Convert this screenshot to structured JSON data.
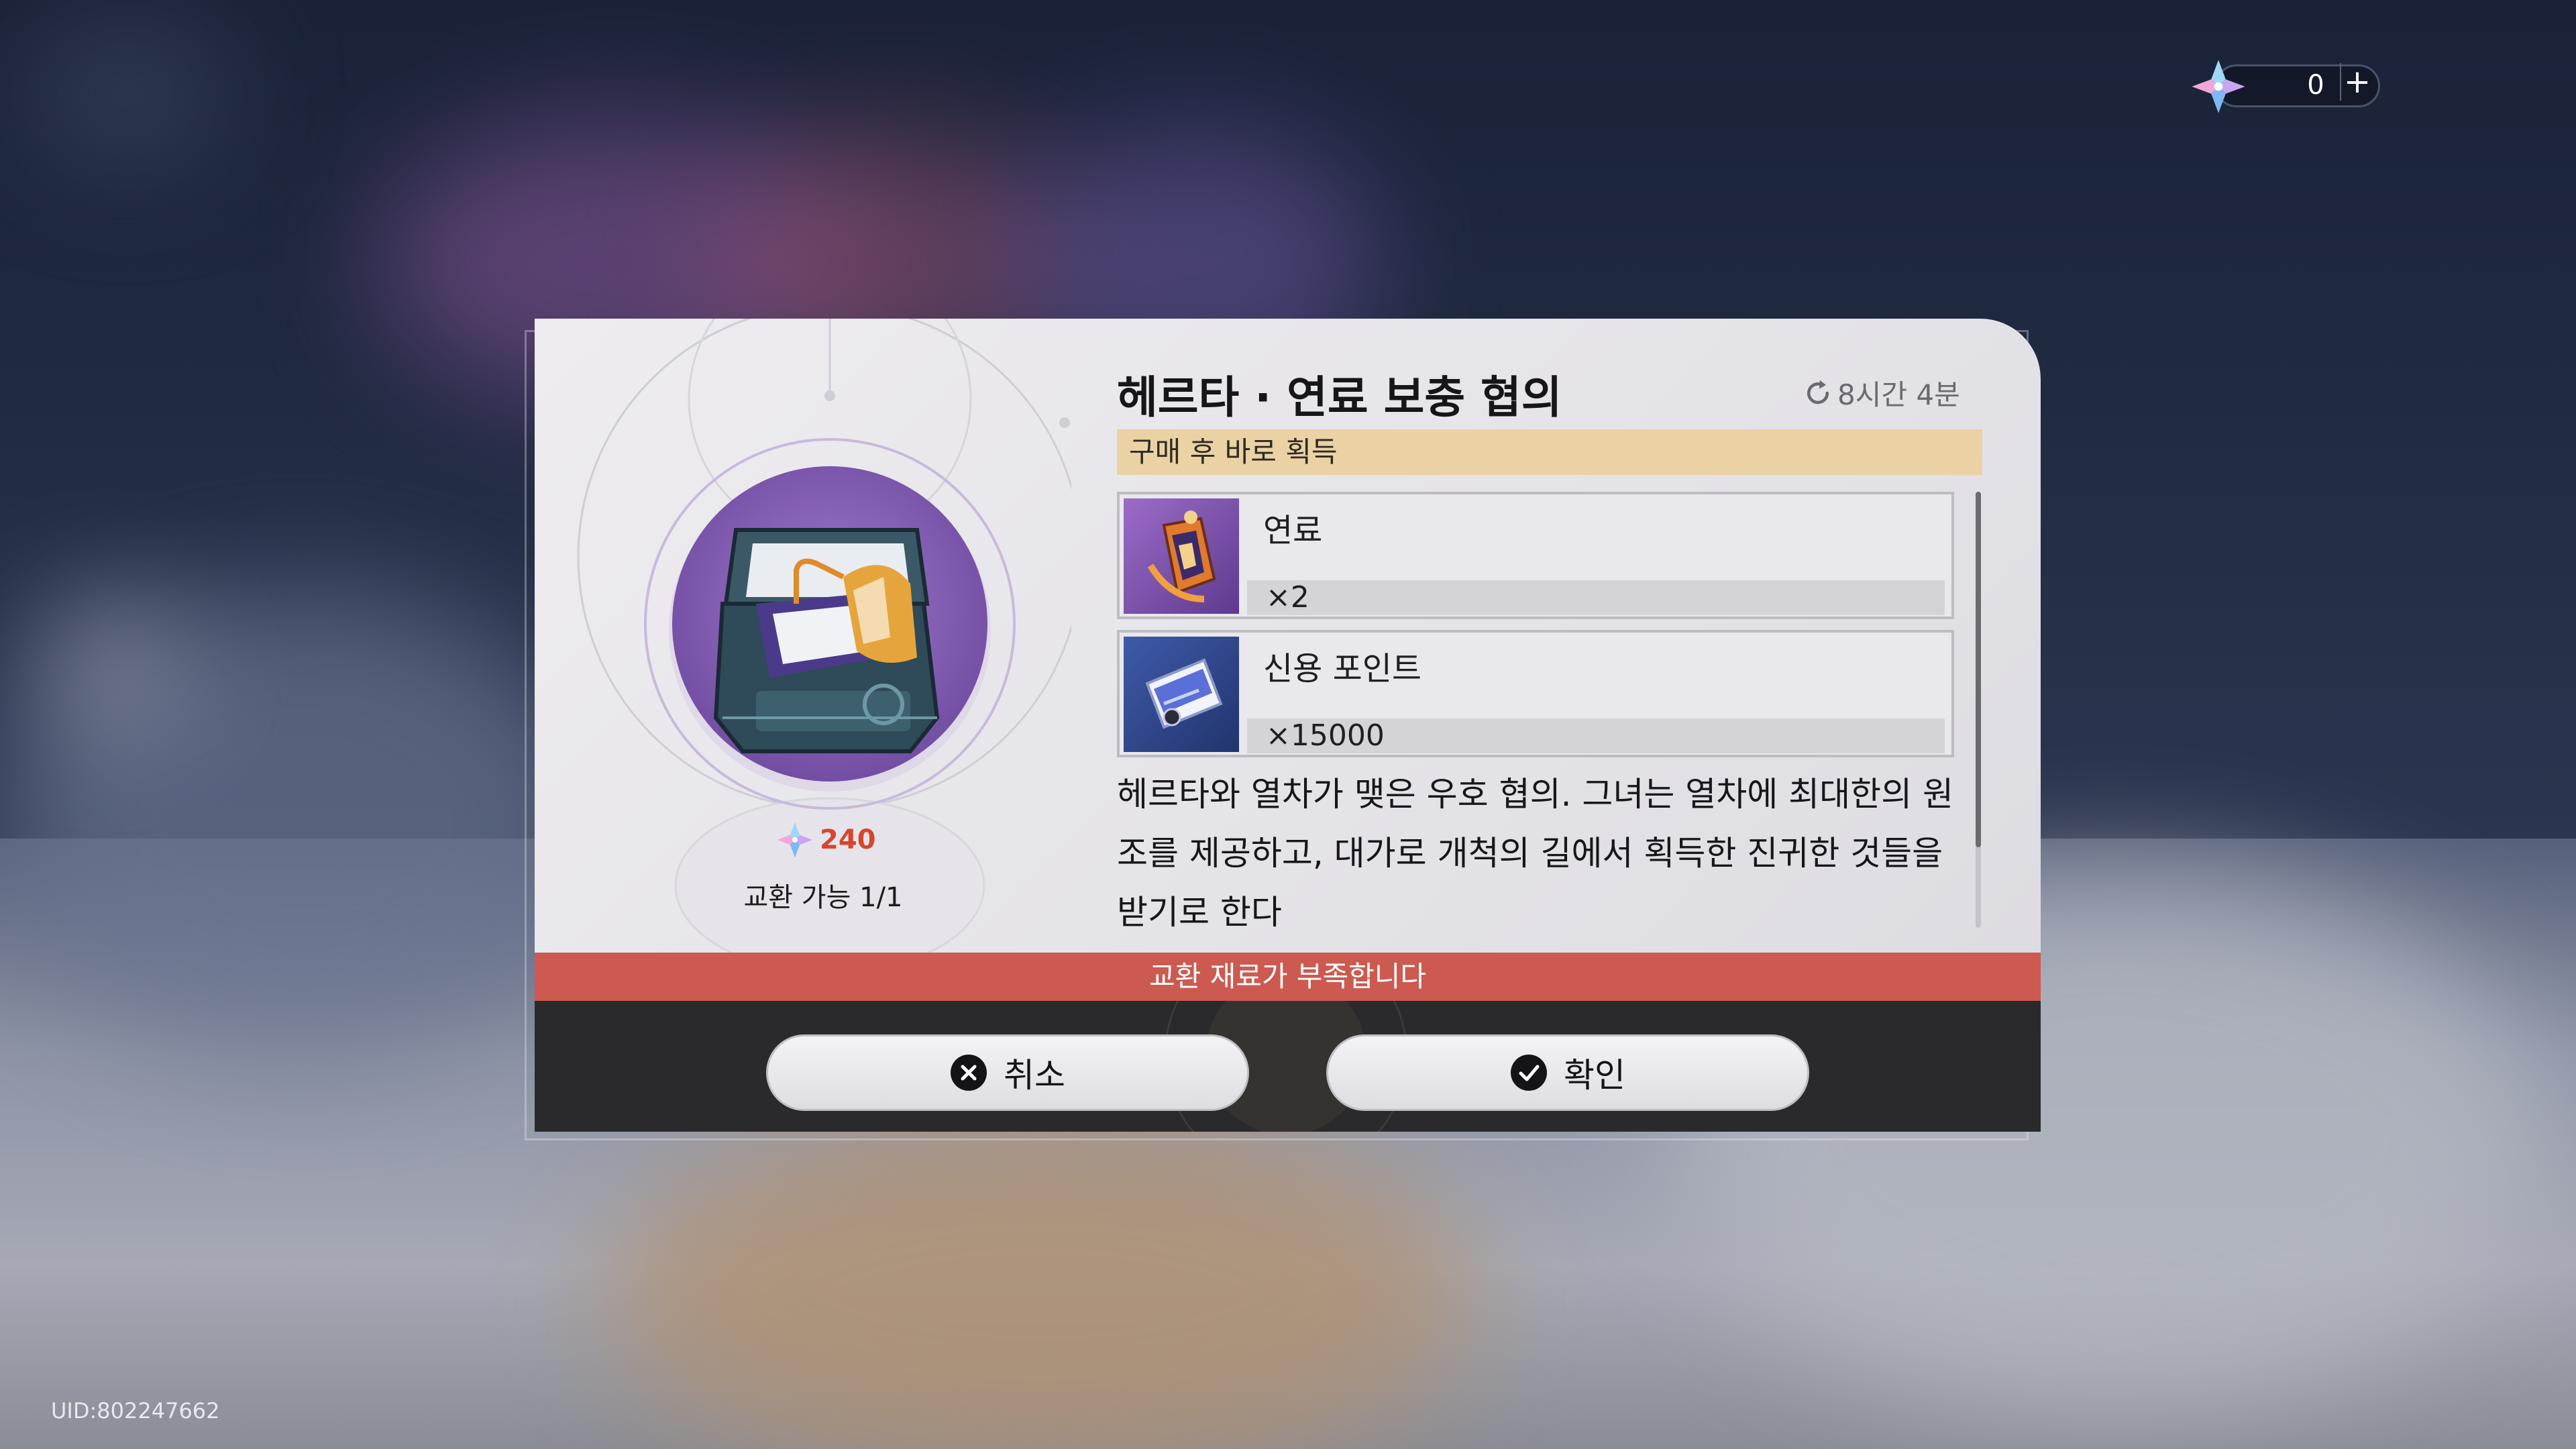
{
  "hud": {
    "currency_value": "0",
    "currency_plus": "+",
    "uid": "UID:802247662"
  },
  "dialog": {
    "title": "헤르타 · 연료 보충 협의",
    "timer": "8시간 4분",
    "obtain_note": "구매 후 바로 획득",
    "price": "240",
    "exchange_limit": "교환 가능 1/1",
    "rewards": [
      {
        "name": "연료",
        "quantity": "×2",
        "icon": "fuel-icon"
      },
      {
        "name": "신용 포인트",
        "quantity": "×15000",
        "icon": "credit-card-icon"
      }
    ],
    "description": "헤르타와 열차가 맺은 우호 협의. 그녀는 열차에 최대한의 원조를 제공하고, 대가로 개척의 길에서 획득한 진귀한 것들을 받기로 한다",
    "warning": "교환 재료가 부족합니다",
    "cancel_label": "취소",
    "confirm_label": "확인"
  },
  "colors": {
    "warning_bar": "#cc5a50",
    "price_text": "#d5462e",
    "obtain_banner": "#ead2a4",
    "footer": "#2a292c"
  }
}
